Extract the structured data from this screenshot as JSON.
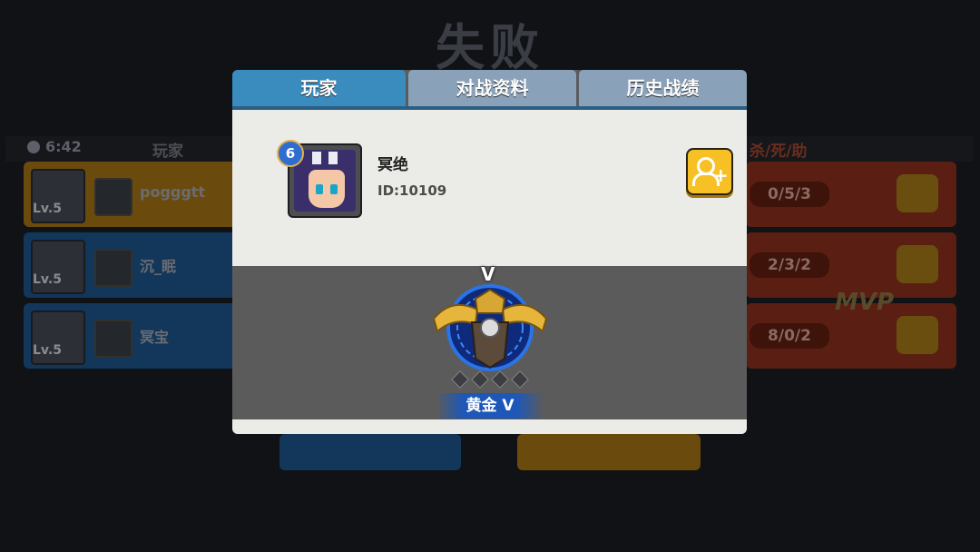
{
  "background": {
    "result_title": "失败",
    "timer": "6:42",
    "col_player": "玩家",
    "col_kda": "杀/死/助",
    "left_rows": [
      {
        "level": "Lv.5",
        "name": "pogggtt",
        "color": "#6a4a0d"
      },
      {
        "level": "Lv.5",
        "name": "沉_眠",
        "color": "#12375a"
      },
      {
        "level": "Lv.5",
        "name": "冥宝",
        "color": "#12375a"
      }
    ],
    "right_rows": [
      {
        "kda": "0/5/3"
      },
      {
        "kda": "2/3/2"
      },
      {
        "kda": "8/0/2"
      }
    ],
    "mvp_label": "MVP"
  },
  "modal": {
    "tabs": [
      {
        "label": "玩家",
        "active": true
      },
      {
        "label": "对战资料",
        "active": false
      },
      {
        "label": "历史战绩",
        "active": false
      }
    ],
    "player": {
      "level": "6",
      "name": "冥绝",
      "id_text": "ID:10109"
    },
    "add_friend_icon": "add-friend-icon",
    "rank": {
      "roman_top": "V",
      "label": "黄金 V",
      "stars_filled": 0,
      "stars_total": 4
    }
  },
  "colors": {
    "tab_active": "#3a8cbf",
    "tab_inactive": "#8aa2b9",
    "add_button": "#f7c024",
    "rank_band": "#1d58b9"
  }
}
